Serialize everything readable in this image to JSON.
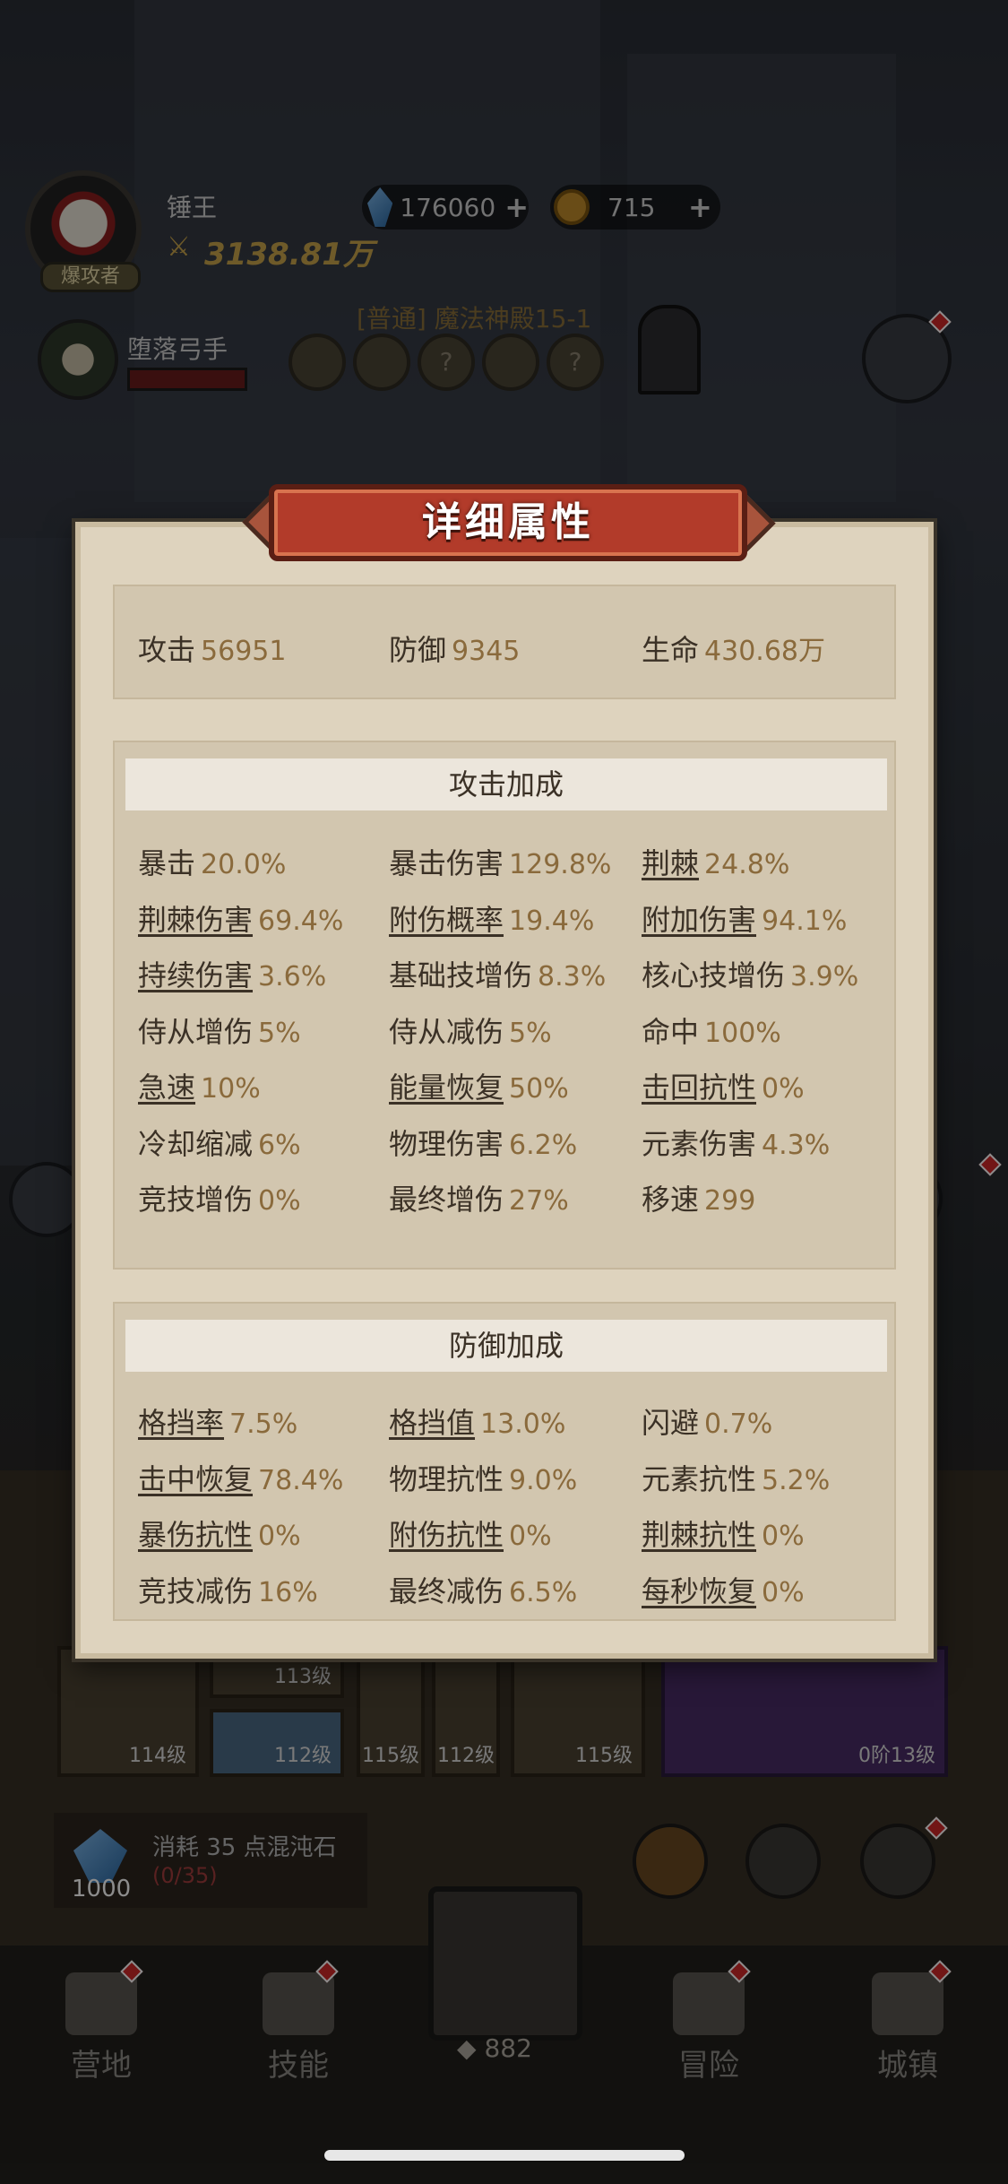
{
  "hud": {
    "player_name": "锤王",
    "player_badge": "爆攻者",
    "power": "3138.81万",
    "crystals": "176060",
    "coins": "715",
    "plus": "+",
    "enemy_name": "堕落弓手",
    "stage": "[普通] 魔法神殿15-1",
    "stage_nodes": [
      "",
      "",
      "?",
      "",
      "?"
    ]
  },
  "modal": {
    "title": "详细属性",
    "summary": [
      {
        "label": "攻击",
        "value": "56951"
      },
      {
        "label": "防御",
        "value": "9345"
      },
      {
        "label": "生命",
        "value": "430.68万"
      }
    ],
    "attack_section": {
      "title": "攻击加成",
      "rows": [
        [
          {
            "label": "暴击",
            "value": "20.0%",
            "link": false
          },
          {
            "label": "暴击伤害",
            "value": "129.8%",
            "link": false
          },
          {
            "label": "荆棘",
            "value": "24.8%",
            "link": true
          }
        ],
        [
          {
            "label": "荆棘伤害",
            "value": "69.4%",
            "link": true
          },
          {
            "label": "附伤概率",
            "value": "19.4%",
            "link": true
          },
          {
            "label": "附加伤害",
            "value": "94.1%",
            "link": true
          }
        ],
        [
          {
            "label": "持续伤害",
            "value": "3.6%",
            "link": true
          },
          {
            "label": "基础技增伤",
            "value": "8.3%",
            "link": false
          },
          {
            "label": "核心技增伤",
            "value": "3.9%",
            "link": false
          }
        ],
        [
          {
            "label": "侍从增伤",
            "value": "5%",
            "link": false
          },
          {
            "label": "侍从减伤",
            "value": "5%",
            "link": false
          },
          {
            "label": "命中",
            "value": "100%",
            "link": false
          }
        ],
        [
          {
            "label": "急速",
            "value": "10%",
            "link": true
          },
          {
            "label": "能量恢复",
            "value": "50%",
            "link": true
          },
          {
            "label": "击回抗性",
            "value": "0%",
            "link": true
          }
        ],
        [
          {
            "label": "冷却缩减",
            "value": "6%",
            "link": false
          },
          {
            "label": "物理伤害",
            "value": "6.2%",
            "link": false
          },
          {
            "label": "元素伤害",
            "value": "4.3%",
            "link": false
          }
        ],
        [
          {
            "label": "竞技增伤",
            "value": "0%",
            "link": false
          },
          {
            "label": "最终增伤",
            "value": "27%",
            "link": false
          },
          {
            "label": "移速",
            "value": "299",
            "link": false
          }
        ]
      ]
    },
    "defense_section": {
      "title": "防御加成",
      "rows": [
        [
          {
            "label": "格挡率",
            "value": "7.5%",
            "link": true
          },
          {
            "label": "格挡值",
            "value": "13.0%",
            "link": true
          },
          {
            "label": "闪避",
            "value": "0.7%",
            "link": false
          }
        ],
        [
          {
            "label": "击中恢复",
            "value": "78.4%",
            "link": true
          },
          {
            "label": "物理抗性",
            "value": "9.0%",
            "link": false
          },
          {
            "label": "元素抗性",
            "value": "5.2%",
            "link": false
          }
        ],
        [
          {
            "label": "暴伤抗性",
            "value": "0%",
            "link": true
          },
          {
            "label": "附伤抗性",
            "value": "0%",
            "link": true
          },
          {
            "label": "荆棘抗性",
            "value": "0%",
            "link": true
          }
        ],
        [
          {
            "label": "竞技减伤",
            "value": "16%",
            "link": false
          },
          {
            "label": "最终减伤",
            "value": "6.5%",
            "link": false
          },
          {
            "label": "每秒恢复",
            "value": "0%",
            "link": true
          }
        ]
      ]
    }
  },
  "equipment": {
    "levels": [
      "114级",
      "113级",
      "112级",
      "115级",
      "112级",
      "115级",
      "0阶13级"
    ]
  },
  "chaos": {
    "text": "消耗 35 点混沌石",
    "progress": "(0/35)",
    "count": "1000"
  },
  "nav": {
    "items": [
      "营地",
      "技能",
      "冒险",
      "城镇"
    ],
    "center_count": "882"
  },
  "colors": {
    "modal_bg": "#ded3be",
    "banner": "#b23b2a",
    "label_text": "#3b3126",
    "value_text": "#8a6a3c"
  }
}
